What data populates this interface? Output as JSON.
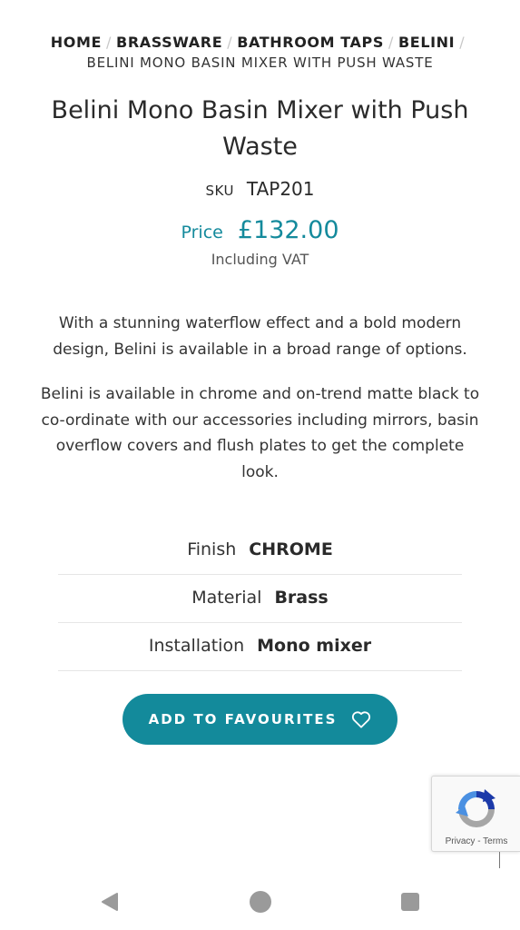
{
  "breadcrumb": {
    "items": [
      "HOME",
      "BRASSWARE",
      "BATHROOM TAPS",
      "BELINI"
    ],
    "separator": "/",
    "current": "BELINI MONO BASIN MIXER WITH PUSH WASTE"
  },
  "product": {
    "title": "Belini Mono Basin Mixer with Push Waste",
    "sku_label": "SKU",
    "sku": "TAP201",
    "price_label": "Price",
    "price": "£132.00",
    "vat_note": "Including VAT",
    "description": [
      "With a stunning waterflow effect and a bold modern design, Belini is available in a broad range of options.",
      "Belini is available in chrome and on-trend matte black to co-ordinate with our accessories including mirrors, basin overflow covers and flush plates to get the complete look."
    ],
    "specs": [
      {
        "label": "Finish",
        "value": "CHROME"
      },
      {
        "label": "Material",
        "value": "Brass"
      },
      {
        "label": "Installation",
        "value": "Mono mixer"
      }
    ]
  },
  "actions": {
    "favourites_label": "ADD TO FAVOURITES",
    "favourites_icon": "heart-outline-icon"
  },
  "recaptcha": {
    "privacy": "Privacy",
    "separator": "-",
    "terms": "Terms"
  },
  "navbar": {
    "icons": [
      "back-triangle-icon",
      "home-circle-icon",
      "recents-square-icon"
    ]
  },
  "colors": {
    "accent": "#138a9b",
    "text": "#2b2b2b",
    "divider": "#e6e6e6"
  }
}
